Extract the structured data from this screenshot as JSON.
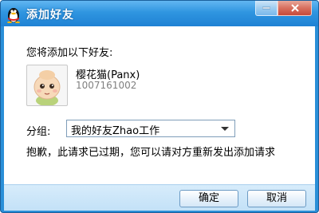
{
  "window": {
    "title": "添加好友",
    "minimize_glyph": "—",
    "close_glyph": "✕"
  },
  "prompt": "您将添加以下好友:",
  "friend": {
    "nickname": "樱花猫(Panx)",
    "qq_number": "1007161002",
    "avatar_icon": "baby-avatar-icon"
  },
  "group": {
    "label": "分组:",
    "selected": "我的好友Zhao工作"
  },
  "message": "抱歉，此请求已过期，您可以请对方重新发出添加请求",
  "buttons": {
    "ok": "确定",
    "cancel": "取消"
  },
  "colors": {
    "titlebar": "#2f95e0",
    "footer": "#c3e1f7"
  }
}
